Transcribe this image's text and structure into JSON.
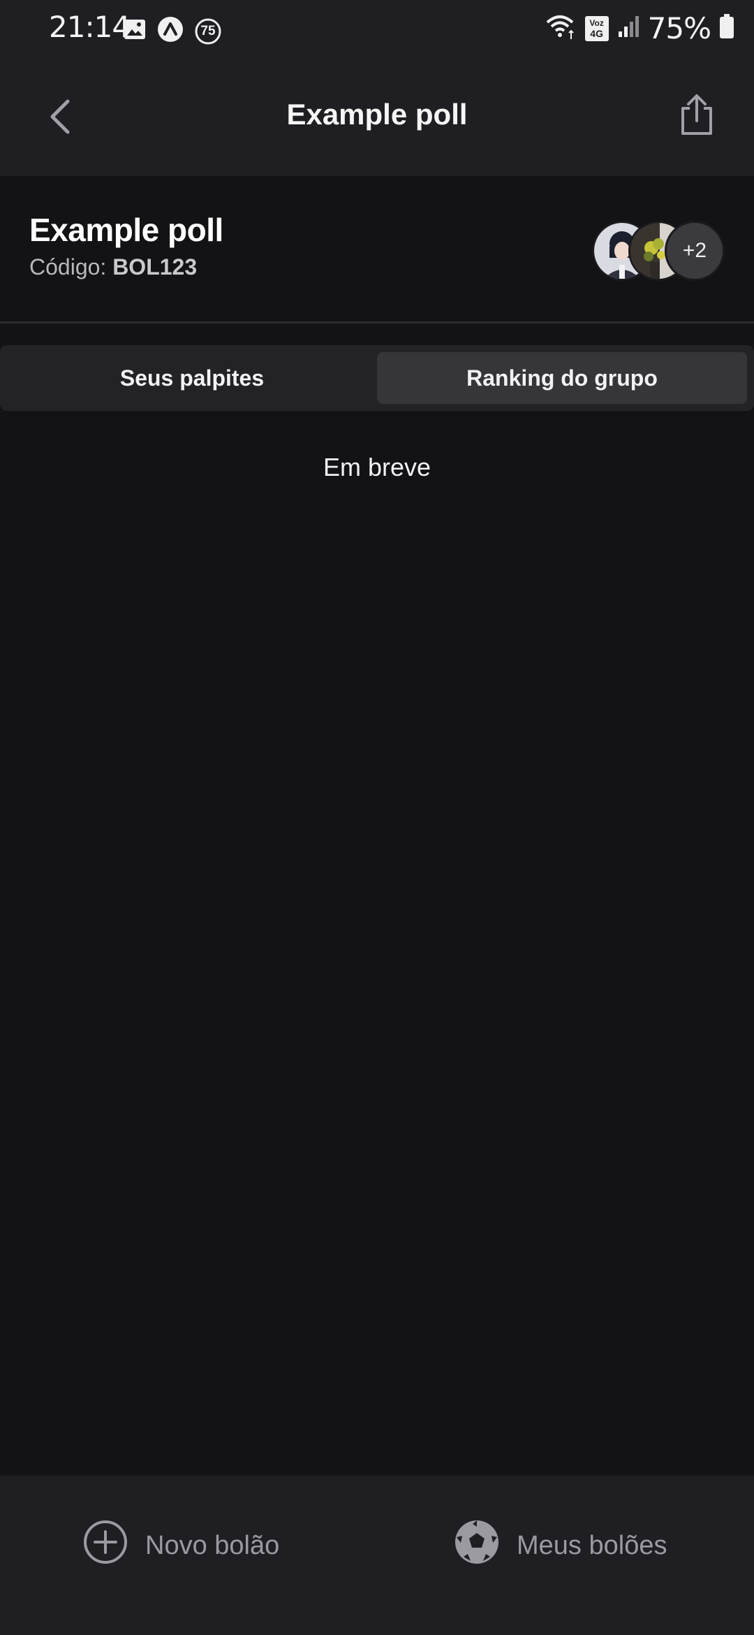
{
  "status_bar": {
    "time": "21:14",
    "notification_count": "75",
    "network_badge_top": "Voz",
    "network_badge_bottom": "4G",
    "battery": "75%"
  },
  "app_bar": {
    "title": "Example poll"
  },
  "poll": {
    "title": "Example poll",
    "code_label": "Código:",
    "code_value": "BOL123",
    "extra_members": "+2"
  },
  "tabs": [
    {
      "label": "Seus palpites",
      "selected": false
    },
    {
      "label": "Ranking do grupo",
      "selected": true
    }
  ],
  "content": {
    "message": "Em breve"
  },
  "bottom_nav": {
    "new_label": "Novo bolão",
    "mine_label": "Meus bolões"
  },
  "colors": {
    "background": "#131315",
    "bar": "#1f1f23",
    "tab_selected": "#35353a",
    "muted_text": "#9a9aa0"
  }
}
